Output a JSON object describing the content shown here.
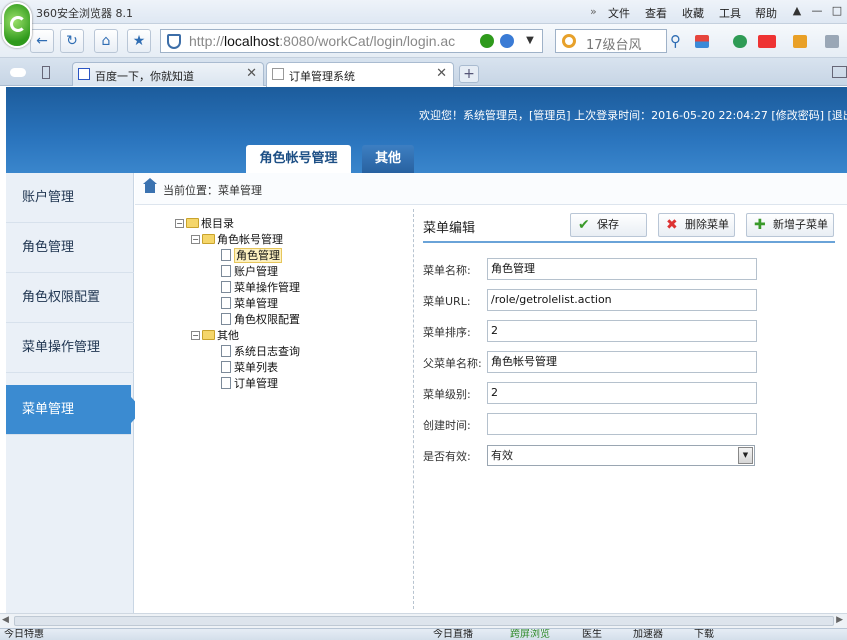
{
  "browser": {
    "app_title": "360安全浏览器 8.1",
    "menus": [
      "文件",
      "查看",
      "收藏",
      "工具",
      "帮助"
    ],
    "address": {
      "host": "localhost",
      "rest": ":8080/workCat/login/login.ac",
      "prefix": "http://"
    },
    "search_placeholder": "17级台风",
    "tabs": [
      {
        "label": "百度一下，你就知道"
      },
      {
        "label": "订单管理系统"
      }
    ]
  },
  "header": {
    "welcome": "欢迎您！系统管理员，[管理员]  上次登录时间：2016-05-20 22:04:27 [修改密码]   [退出系",
    "tabs": [
      "角色帐号管理",
      "其他"
    ]
  },
  "sidebar": {
    "items": [
      "账户管理",
      "角色管理",
      "角色权限配置",
      "菜单操作管理",
      "菜单管理"
    ]
  },
  "location": {
    "label": "当前位置：",
    "value": "菜单管理"
  },
  "tree": {
    "root": "根目录",
    "group1": "角色帐号管理",
    "group1_items": [
      "角色管理",
      "账户管理",
      "菜单操作管理",
      "菜单管理",
      "角色权限配置"
    ],
    "group2": "其他",
    "group2_items": [
      "系统日志查询",
      "菜单列表",
      "订单管理"
    ]
  },
  "edit": {
    "title": "菜单编辑",
    "save": "保存",
    "delete": "删除菜单",
    "add_child": "新增子菜单",
    "fields": {
      "name_label": "菜单名称:",
      "name_value": "角色管理",
      "url_label": "菜单URL:",
      "url_value": "/role/getrolelist.action",
      "order_label": "菜单排序:",
      "order_value": "2",
      "parent_label": "父菜单名称:",
      "parent_value": "角色帐号管理",
      "level_label": "菜单级别:",
      "level_value": "2",
      "created_label": "创建时间:",
      "created_value": "",
      "status_label": "是否有效:",
      "status_value": "有效"
    }
  },
  "statusbar": {
    "left": "今日特惠",
    "items": [
      "今日直播",
      "跨屏浏览",
      "医生",
      "加速器",
      "下载"
    ]
  }
}
